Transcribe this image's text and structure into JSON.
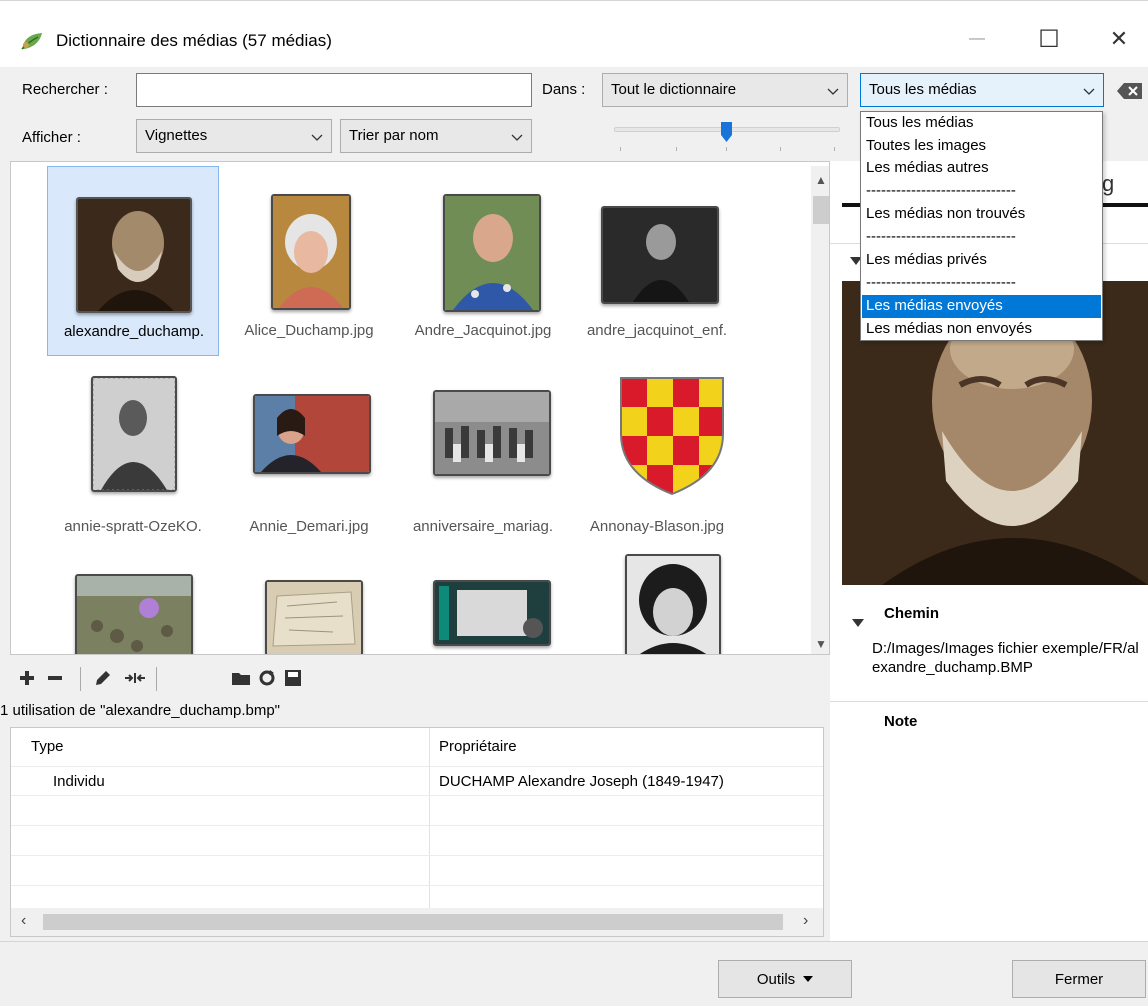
{
  "window": {
    "title": "Dictionnaire des médias (57 médias)",
    "min_glyph": "—",
    "max_glyph": "☐",
    "close_glyph": "✕"
  },
  "search": {
    "label": "Rechercher :",
    "value": "",
    "placeholder": "",
    "scope_label": "Dans :",
    "scope_value": "Tout le dictionnaire",
    "filter_value": "Tous les médias"
  },
  "display": {
    "label": "Afficher :",
    "view_value": "Vignettes",
    "sort_value": "Trier par nom"
  },
  "gallery": {
    "items": [
      {
        "caption": "alexandre_duchamp.",
        "selected": true
      },
      {
        "caption": "Alice_Duchamp.jpg"
      },
      {
        "caption": "Andre_Jacquinot.jpg"
      },
      {
        "caption": "andre_jacquinot_enf."
      },
      {
        "caption": "annie-spratt-OzeKO."
      },
      {
        "caption": "Annie_Demari.jpg"
      },
      {
        "caption": "anniversaire_mariag."
      },
      {
        "caption": "Annonay-Blason.jpg"
      }
    ]
  },
  "usage": {
    "label": "1 utilisation de \"alexandre_duchamp.bmp\"",
    "columns": [
      "Type",
      "Propriétaire"
    ],
    "rows": [
      {
        "type": "Individu",
        "owner": "DUCHAMP Alexandre Joseph (1849-1947)"
      }
    ]
  },
  "details": {
    "path_title": "Chemin",
    "path_value": "D:/Images/Images fichier exemple/FR/alexandre_duchamp.BMP",
    "note_title": "Note",
    "tab_fragment": "g"
  },
  "footer": {
    "tools_label": "Outils",
    "close_label": "Fermer"
  },
  "filter_dropdown": {
    "options": [
      "Tous les médias",
      "Toutes les images",
      "Les médias autres",
      "------------------------------",
      "Les médias non trouvés",
      "------------------------------",
      "Les médias privés",
      "------------------------------",
      "Les médias envoyés",
      "Les médias non envoyés"
    ],
    "highlighted_index": 8
  },
  "colors": {
    "accent": "#0078d7",
    "selection_bg": "#d9e9fb"
  }
}
